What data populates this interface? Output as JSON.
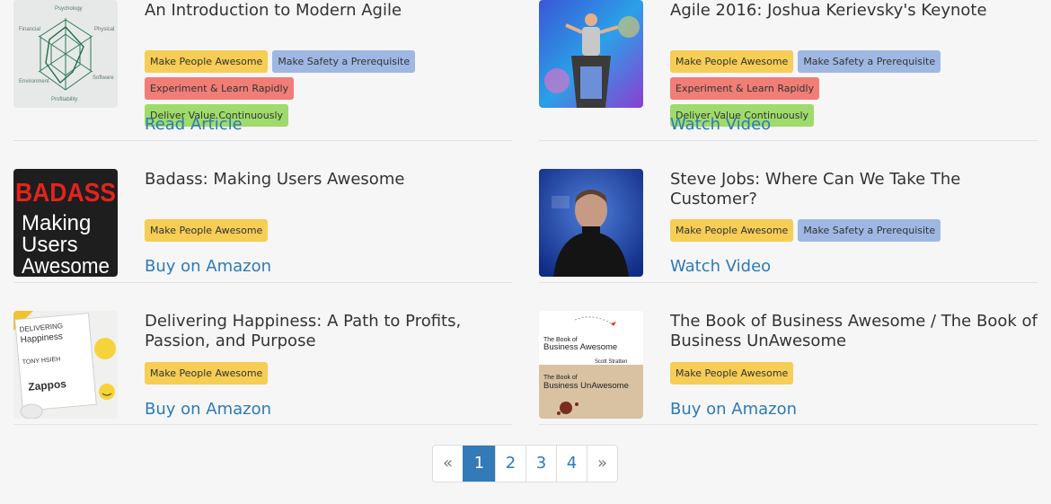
{
  "cards": [
    {
      "title": "An Introduction to Modern Agile",
      "tags": [
        "Make People Awesome",
        "Make Safety a Prerequisite",
        "Experiment & Learn Rapidly",
        "Deliver Value Continuously"
      ],
      "action": "Read Article",
      "thumb_text": [
        "Psychology",
        "Physical",
        "Financial",
        "Software",
        "Environment",
        "Profitability"
      ]
    },
    {
      "title": "Agile 2016: Joshua Kerievsky's Keynote",
      "tags": [
        "Make People Awesome",
        "Make Safety a Prerequisite",
        "Experiment & Learn Rapidly",
        "Deliver Value Continuously"
      ],
      "action": "Watch Video"
    },
    {
      "title": "Badass: Making Users Awesome",
      "tags": [
        "Make People Awesome"
      ],
      "action": "Buy on Amazon",
      "thumb_text": [
        "BADASS",
        "Making",
        "Users",
        "Awesome"
      ]
    },
    {
      "title": "Steve Jobs: Where Can We Take The Customer?",
      "tags": [
        "Make People Awesome",
        "Make Safety a Prerequisite"
      ],
      "action": "Watch Video"
    },
    {
      "title": "Delivering Happiness: A Path to Profits, Passion, and Purpose",
      "tags": [
        "Make People Awesome"
      ],
      "action": "Buy on Amazon",
      "thumb_text": [
        "DELIVERING",
        "Happiness",
        "TONY HSIEH",
        "Zappos"
      ]
    },
    {
      "title": "The Book of Business Awesome / The Book of Business UnAwesome",
      "tags": [
        "Make People Awesome"
      ],
      "action": "Buy on Amazon",
      "thumb_text": [
        "The Book of",
        "Business Awesome",
        "Scott Stratten",
        "The Book of",
        "Business UnAwesome"
      ]
    }
  ],
  "tag_colors": {
    "Make People Awesome": "#f6cd55",
    "Make Safety a Prerequisite": "#9eb8e3",
    "Experiment & Learn Rapidly": "#f07d76",
    "Deliver Value Continuously": "#9fdb6b"
  },
  "pagination": {
    "prev": "«",
    "pages": [
      "1",
      "2",
      "3",
      "4"
    ],
    "current": "1",
    "next": "»"
  }
}
